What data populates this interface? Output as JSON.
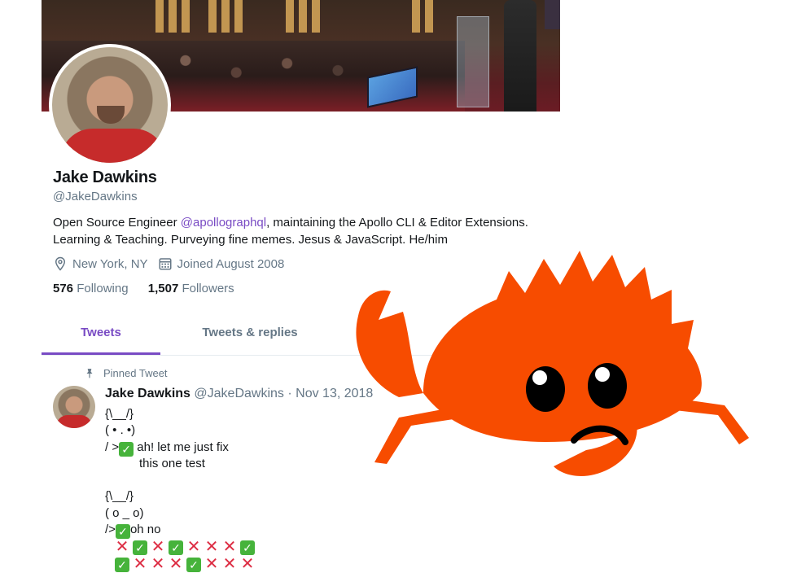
{
  "profile": {
    "name": "Jake Dawkins",
    "handle": "@JakeDawkins",
    "bio_pre": "Open Source Engineer ",
    "bio_mention": "@apollographql",
    "bio_post": ", maintaining the Apollo CLI & Editor Extensions.",
    "bio_line2": "Learning & Teaching. Purveying fine memes. Jesus & JavaScript. He/him",
    "location": "New York, NY",
    "joined": "Joined August 2008",
    "following_count": "576",
    "following_label": "Following",
    "followers_count": "1,507",
    "followers_label": "Followers"
  },
  "tabs": [
    {
      "label": "Tweets",
      "active": true
    },
    {
      "label": "Tweets & replies",
      "active": false
    }
  ],
  "tweet": {
    "pinned_label": "Pinned Tweet",
    "author_name": "Jake Dawkins",
    "author_handle": "@JakeDawkins",
    "separator": "·",
    "date": "Nov 13, 2018",
    "lines": {
      "l1": "{\\__/}",
      "l2": "( • . •)",
      "l3_pre": "/ >",
      "l3_post": " ah! let me just fix",
      "l4": "this one test",
      "l5": "{\\__/}",
      "l6": "( o _ o)",
      "l7_pre": "/>",
      "l7_post": "oh no"
    },
    "emoji_row_1": [
      "x",
      "check",
      "x",
      "check",
      "x",
      "x",
      "x",
      "check"
    ],
    "emoji_row_2": [
      "check",
      "x",
      "x",
      "x",
      "check",
      "x",
      "x",
      "x"
    ]
  },
  "colors": {
    "accent": "#794bc4",
    "ferris": "#f74c00",
    "muted": "#657786",
    "check_green": "#46b33b",
    "x_red": "#dd2e44"
  },
  "icons": {
    "location": "location-pin-icon",
    "calendar": "calendar-icon",
    "pin": "pin-icon"
  }
}
